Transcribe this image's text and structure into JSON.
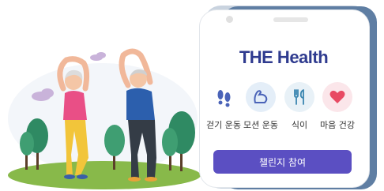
{
  "app": {
    "brand": "THE Health",
    "cta_label": "챌린지 참여"
  },
  "menu": [
    {
      "label": "걷기 운동",
      "icon": "footprints-icon"
    },
    {
      "label": "모션 운동",
      "icon": "muscle-arm-icon"
    },
    {
      "label": "식이",
      "icon": "fork-spoon-icon"
    },
    {
      "label": "마음 건강",
      "icon": "heart-icon"
    }
  ],
  "colors": {
    "brand": "#2f3b8f",
    "cta": "#5b4fc2",
    "phone_back": "#5f7ea3",
    "heart": "#e84a63",
    "ground": "#88b94a"
  }
}
